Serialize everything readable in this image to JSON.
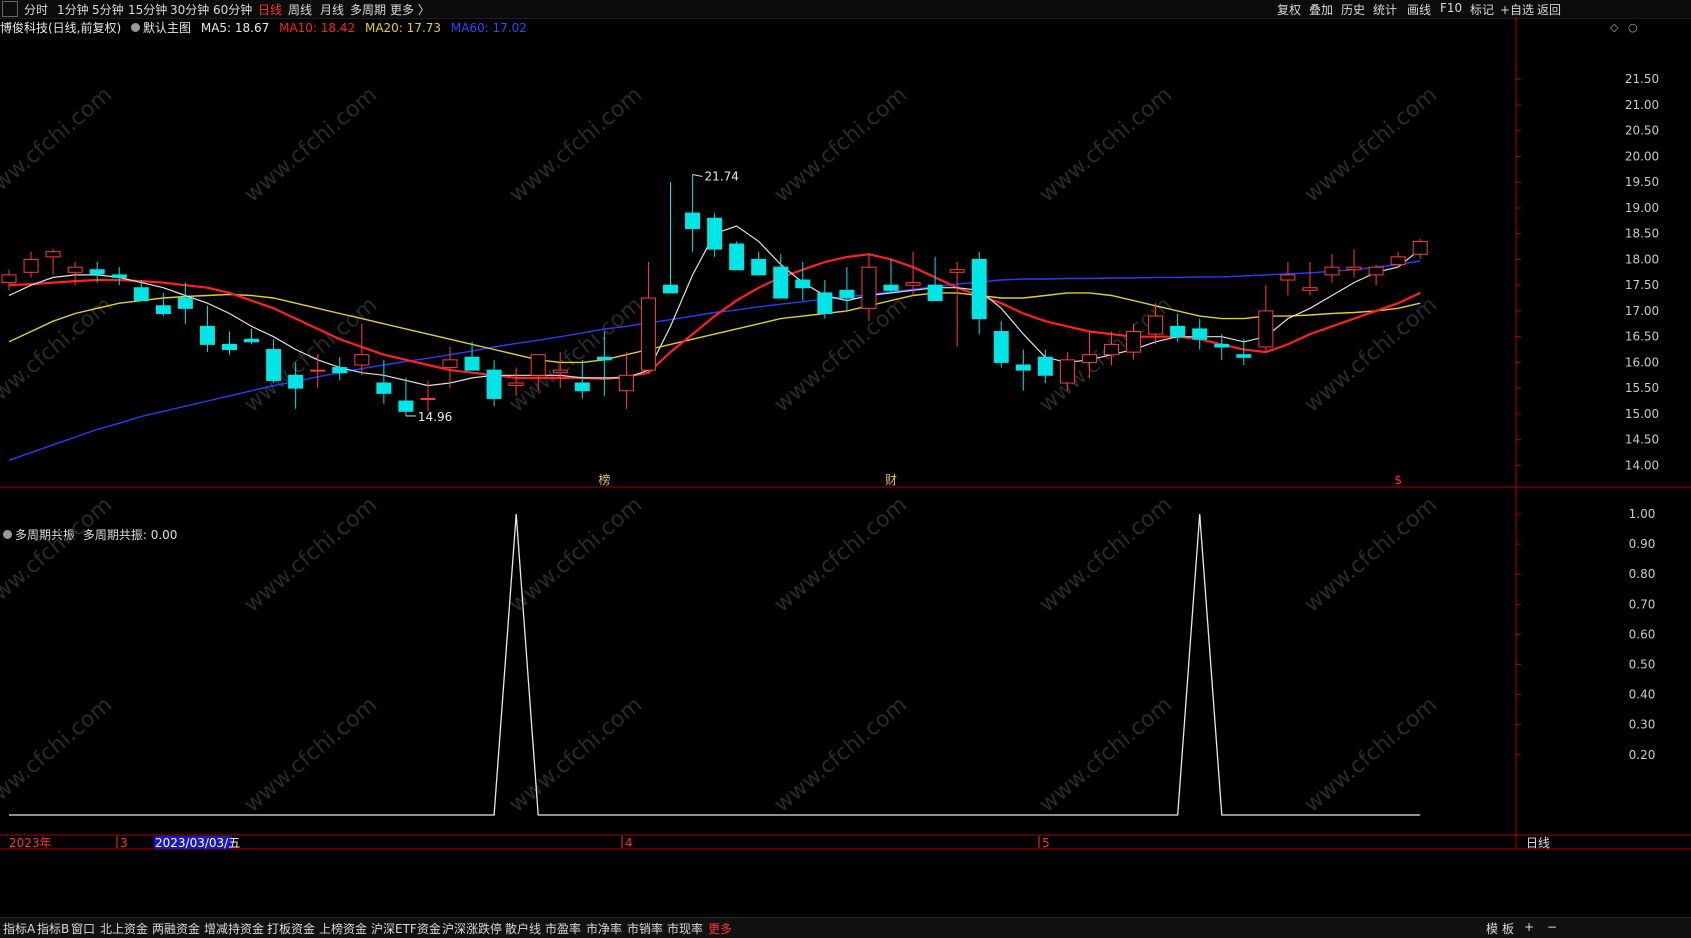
{
  "topbar": {
    "left_items": [
      "分时",
      "1分钟",
      "5分钟",
      "15分钟",
      "30分钟",
      "60分钟",
      "日线",
      "周线",
      "月线",
      "多周期",
      "更多 〉"
    ],
    "active_index": 6,
    "right_items": [
      "复权",
      "叠加",
      "历史",
      "统计",
      "画线",
      "F10",
      "标记",
      "+自选",
      "返回"
    ]
  },
  "info": {
    "stock": "博俊科技(日线,前复权)",
    "main_chart": "默认主图",
    "ma5": "MA5: 18.67",
    "ma10": "MA10: 18.42",
    "ma20": "MA20: 17.73",
    "ma60": "MA60: 17.02"
  },
  "colors": {
    "up": "#ff3b3b",
    "down": "#00e5e5",
    "ma5": "#e0e0e0",
    "ma10": "#ff2020",
    "ma20": "#e0d020",
    "ma60": "#2a3cff",
    "axis": "#b00000",
    "watermark": "#2a2a2a"
  },
  "price_axis": {
    "ticks": [
      "21.50",
      "21.00",
      "20.50",
      "20.00",
      "19.50",
      "19.00",
      "18.50",
      "18.00",
      "17.50",
      "17.00",
      "16.50",
      "16.00",
      "15.50",
      "15.00",
      "14.50",
      "14.00"
    ],
    "ylim": [
      13.6,
      22.3
    ]
  },
  "annotations": {
    "high": "21.74",
    "low": "14.96",
    "markers": [
      "榜",
      "财",
      "$"
    ]
  },
  "indicator": {
    "title": "多周期共振",
    "value_text": "多周期共振: 0.00",
    "ticks": [
      "1.00",
      "0.90",
      "0.80",
      "0.70",
      "0.60",
      "0.50",
      "0.40",
      "0.30",
      "0.20"
    ],
    "ylim": [
      -0.05,
      1.02
    ],
    "values": [
      0,
      0,
      0,
      0,
      0,
      0,
      0,
      0,
      0,
      0,
      0,
      0,
      0,
      0,
      0,
      0,
      0,
      0,
      0,
      0,
      0,
      0,
      0,
      1,
      0,
      0,
      0,
      0,
      0,
      0,
      0,
      0,
      0,
      0,
      0,
      0,
      0,
      0,
      0,
      0,
      0,
      0,
      0,
      0,
      0,
      0,
      0,
      0,
      0,
      0,
      0,
      0,
      0,
      0,
      1,
      0,
      0,
      0,
      0,
      0,
      0,
      0,
      0,
      0,
      0
    ]
  },
  "date_axis": {
    "labels": [
      "2023年",
      "3",
      "2023/03/03/五",
      "4",
      "5"
    ],
    "period": "日线"
  },
  "watermark": "www.cfchi.com",
  "bottombar": {
    "items": [
      "指标A",
      "指标B",
      "窗口",
      "北上资金",
      "两融资金",
      "增减持资金",
      "打板资金",
      "上榜资金",
      "沪深ETF资金",
      "沪深涨跌停",
      "散户线",
      "市盈率",
      "市净率",
      "市销率",
      "市现率",
      "更多"
    ],
    "right_items": [
      "模",
      "板",
      "+",
      "−"
    ]
  },
  "chart_data": {
    "type": "candlestick",
    "title": "博俊科技(日线,前复权)",
    "series_candles": {
      "o": [
        17.55,
        17.75,
        18.05,
        17.75,
        17.8,
        17.7,
        17.45,
        17.1,
        17.25,
        16.7,
        16.35,
        16.45,
        16.25,
        15.75,
        15.85,
        15.9,
        15.95,
        15.6,
        15.25,
        15.3,
        15.9,
        16.1,
        15.85,
        15.55,
        15.75,
        15.8,
        15.6,
        16.1,
        15.45,
        15.85,
        17.5,
        18.9,
        18.8,
        18.3,
        18.0,
        17.85,
        17.6,
        17.35,
        17.4,
        17.05,
        17.5,
        17.5,
        17.5,
        17.75,
        18.0,
        16.6,
        15.95,
        16.1,
        15.6,
        16.0,
        16.15,
        16.2,
        16.55,
        16.7,
        16.65,
        16.35,
        16.15,
        16.3,
        17.6,
        17.4,
        17.7,
        17.8,
        17.7,
        17.9,
        18.1
      ],
      "h": [
        17.8,
        18.15,
        18.2,
        17.95,
        17.95,
        17.85,
        17.6,
        17.35,
        17.55,
        17.1,
        16.6,
        16.65,
        16.45,
        16.0,
        16.15,
        16.1,
        16.75,
        16.05,
        15.7,
        15.65,
        16.3,
        16.4,
        16.05,
        15.9,
        16.15,
        16.2,
        16.05,
        16.6,
        16.2,
        17.95,
        19.5,
        19.65,
        18.9,
        18.35,
        18.15,
        18.1,
        17.95,
        17.6,
        17.85,
        18.1,
        18.0,
        18.15,
        18.05,
        17.95,
        18.15,
        16.8,
        16.25,
        16.25,
        16.2,
        16.6,
        16.6,
        16.75,
        17.15,
        16.95,
        16.85,
        16.55,
        16.45,
        17.5,
        17.95,
        17.95,
        18.1,
        18.2,
        17.9,
        18.15,
        18.4
      ],
      "l": [
        17.4,
        17.65,
        17.7,
        17.5,
        17.55,
        17.5,
        17.3,
        16.9,
        16.75,
        16.2,
        16.15,
        16.35,
        15.6,
        15.1,
        15.5,
        15.65,
        15.75,
        15.2,
        14.96,
        15.05,
        15.5,
        15.85,
        15.15,
        15.35,
        15.45,
        15.5,
        15.3,
        15.35,
        15.1,
        15.8,
        17.35,
        18.15,
        18.05,
        17.8,
        17.75,
        17.25,
        17.2,
        16.85,
        17.0,
        16.8,
        17.35,
        17.3,
        17.35,
        16.3,
        16.55,
        15.9,
        15.45,
        15.6,
        15.45,
        15.7,
        15.95,
        16.05,
        16.35,
        16.4,
        16.25,
        16.05,
        15.95,
        16.2,
        17.3,
        17.3,
        17.55,
        17.65,
        17.5,
        17.85,
        18.0
      ],
      "c": [
        17.7,
        18.0,
        18.15,
        17.85,
        17.72,
        17.65,
        17.2,
        16.95,
        17.05,
        16.35,
        16.25,
        16.4,
        15.65,
        15.5,
        15.85,
        15.8,
        16.15,
        15.4,
        15.05,
        15.3,
        16.05,
        15.85,
        15.3,
        15.6,
        16.15,
        15.85,
        15.45,
        16.05,
        15.75,
        17.25,
        17.35,
        18.6,
        18.2,
        17.8,
        17.7,
        17.25,
        17.45,
        16.95,
        17.25,
        17.85,
        17.4,
        17.55,
        17.2,
        17.8,
        16.85,
        16.0,
        15.85,
        15.75,
        16.05,
        16.15,
        16.35,
        16.6,
        16.9,
        16.5,
        16.45,
        16.3,
        16.1,
        17.0,
        17.7,
        17.45,
        17.85,
        17.85,
        17.85,
        18.05,
        18.35
      ],
      "ma5": [
        17.3,
        17.5,
        17.65,
        17.7,
        17.7,
        17.65,
        17.55,
        17.45,
        17.3,
        17.15,
        16.95,
        16.7,
        16.5,
        16.25,
        16.05,
        15.9,
        15.8,
        15.75,
        15.65,
        15.55,
        15.6,
        15.7,
        15.75,
        15.75,
        15.75,
        15.75,
        15.7,
        15.7,
        15.7,
        15.85,
        16.7,
        17.7,
        18.5,
        18.65,
        18.35,
        17.9,
        17.55,
        17.3,
        17.2,
        17.3,
        17.35,
        17.4,
        17.45,
        17.45,
        17.4,
        17.05,
        16.55,
        16.1,
        16.0,
        16.05,
        16.15,
        16.25,
        16.4,
        16.5,
        16.5,
        16.5,
        16.4,
        16.5,
        16.85,
        17.05,
        17.3,
        17.55,
        17.75,
        17.85,
        18.2
      ],
      "ma10": [
        17.5,
        17.52,
        17.55,
        17.58,
        17.6,
        17.6,
        17.58,
        17.55,
        17.5,
        17.45,
        17.35,
        17.2,
        17.05,
        16.85,
        16.65,
        16.45,
        16.3,
        16.15,
        16.05,
        15.95,
        15.85,
        15.8,
        15.75,
        15.7,
        15.7,
        15.7,
        15.7,
        15.68,
        15.72,
        15.8,
        16.2,
        16.55,
        16.9,
        17.2,
        17.45,
        17.65,
        17.8,
        17.95,
        18.05,
        18.1,
        18.0,
        17.85,
        17.65,
        17.45,
        17.3,
        17.15,
        16.95,
        16.8,
        16.7,
        16.6,
        16.55,
        16.5,
        16.5,
        16.5,
        16.45,
        16.35,
        16.25,
        16.2,
        16.35,
        16.55,
        16.7,
        16.85,
        17.0,
        17.15,
        17.35
      ],
      "ma20": [
        16.4,
        16.6,
        16.8,
        16.95,
        17.05,
        17.15,
        17.2,
        17.25,
        17.28,
        17.3,
        17.32,
        17.3,
        17.25,
        17.15,
        17.05,
        16.95,
        16.85,
        16.75,
        16.65,
        16.55,
        16.45,
        16.35,
        16.25,
        16.15,
        16.05,
        16.0,
        16.0,
        16.05,
        16.15,
        16.25,
        16.35,
        16.45,
        16.55,
        16.65,
        16.75,
        16.85,
        16.9,
        16.95,
        17.0,
        17.1,
        17.2,
        17.3,
        17.35,
        17.35,
        17.3,
        17.25,
        17.25,
        17.3,
        17.35,
        17.35,
        17.3,
        17.2,
        17.1,
        17.0,
        16.9,
        16.85,
        16.85,
        16.9,
        16.9,
        16.92,
        16.95,
        16.97,
        17.0,
        17.05,
        17.15
      ],
      "ma60": [
        14.1,
        14.25,
        14.4,
        14.55,
        14.7,
        14.82,
        14.95,
        15.05,
        15.15,
        15.25,
        15.35,
        15.45,
        15.55,
        15.63,
        15.72,
        15.8,
        15.88,
        15.95,
        16.02,
        16.08,
        16.15,
        16.22,
        16.3,
        16.37,
        16.43,
        16.5,
        16.57,
        16.65,
        16.7,
        16.77,
        16.83,
        16.9,
        16.97,
        17.02,
        17.08,
        17.13,
        17.18,
        17.23,
        17.27,
        17.32,
        17.37,
        17.42,
        17.47,
        17.52,
        17.56,
        17.6,
        17.62,
        17.62,
        17.63,
        17.63,
        17.64,
        17.64,
        17.65,
        17.65,
        17.66,
        17.66,
        17.68,
        17.7,
        17.72,
        17.74,
        17.77,
        17.8,
        17.85,
        17.9,
        17.97
      ]
    },
    "ylim": [
      13.6,
      22.3
    ],
    "xlabel": "",
    "ylabel": ""
  }
}
